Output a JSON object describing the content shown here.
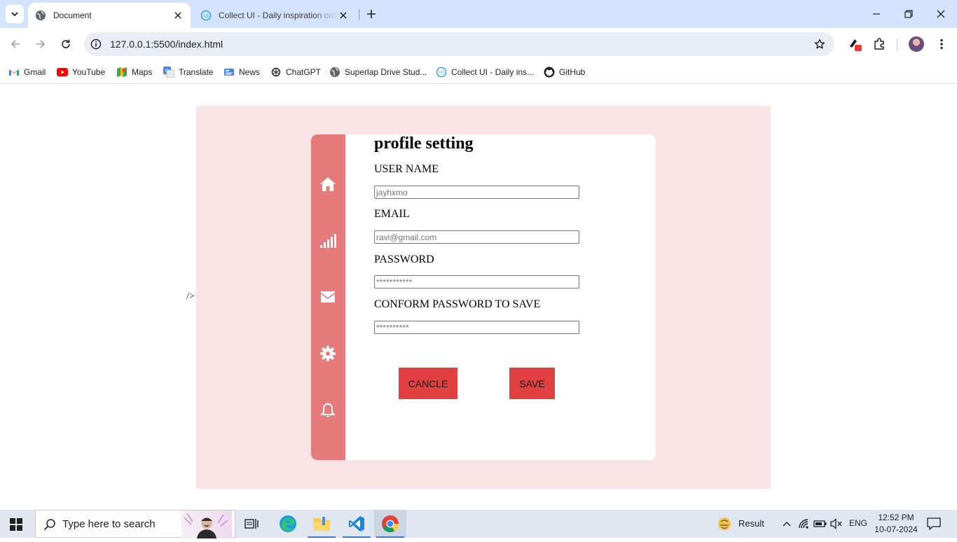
{
  "browser": {
    "tabs": [
      {
        "title": "Document",
        "favicon": "globe-icon",
        "active": true
      },
      {
        "title": "Collect UI - Daily inspiration collected",
        "favicon": "collectui-icon",
        "active": false
      }
    ],
    "url": "127.0.0.1:5500/index.html",
    "bookmarks": [
      {
        "label": "Gmail",
        "icon": "gmail-icon"
      },
      {
        "label": "YouTube",
        "icon": "youtube-icon"
      },
      {
        "label": "Maps",
        "icon": "maps-icon"
      },
      {
        "label": "Translate",
        "icon": "translate-icon"
      },
      {
        "label": "News",
        "icon": "news-icon"
      },
      {
        "label": "ChatGPT",
        "icon": "chatgpt-icon"
      },
      {
        "label": "Superlap Drive Stud...",
        "icon": "globe-icon"
      },
      {
        "label": "Collect UI - Daily ins...",
        "icon": "collectui-icon"
      },
      {
        "label": "GitHub",
        "icon": "github-icon"
      }
    ]
  },
  "page": {
    "stray_text": "/>",
    "title": "profile setting",
    "sidebar_icons": [
      "home-icon",
      "signal-icon",
      "mail-icon",
      "gear-icon",
      "bell-icon"
    ],
    "fields": {
      "username": {
        "label": "USER NAME",
        "placeholder": "jayhxmo"
      },
      "email": {
        "label": "EMAIL",
        "placeholder": "ravi@gmail.com"
      },
      "password": {
        "label": "PASSWORD",
        "placeholder": "***********"
      },
      "confirm": {
        "label": "CONFORM PASSWORD TO SAVE",
        "placeholder": "**********"
      }
    },
    "buttons": {
      "cancel": "CANCLE",
      "save": "SAVE"
    },
    "colors": {
      "background": "#f9e3e4",
      "sidebar": "#e57b7b",
      "button": "#e04040"
    }
  },
  "taskbar": {
    "search_placeholder": "Type here to search",
    "weather": "Result",
    "language": "ENG",
    "time": "12:52 PM",
    "date": "10-07-2024"
  }
}
